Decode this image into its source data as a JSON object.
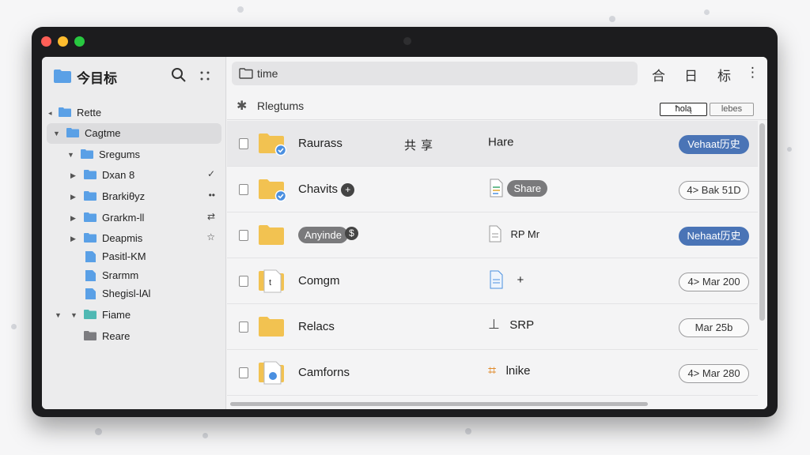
{
  "colors": {
    "accent": "#4a74b6",
    "folder": "#5aa0e6",
    "folder_yellow": "#f2c251",
    "traffic_red": "#ff5f57",
    "traffic_yellow": "#febc2e",
    "traffic_green": "#28c840"
  },
  "sidebar": {
    "title": "今目标",
    "icons": [
      "folder-icon",
      "search-icon",
      "grid-icon"
    ],
    "items": [
      {
        "label": "Rette",
        "chevron": "◂",
        "trail": ""
      },
      {
        "label": "Cagtme",
        "chevron": "▼",
        "trail": ""
      },
      {
        "label": "Sregums",
        "chevron": "▼",
        "trail": ""
      },
      {
        "label": "Dxan 8",
        "chevron": "▶",
        "trail": "✓"
      },
      {
        "label": "Brarkiθyz",
        "chevron": "▶",
        "trail": "••"
      },
      {
        "label": "Grarkm-ll",
        "chevron": "▶",
        "trail": "⇄"
      },
      {
        "label": "Deapmis",
        "chevron": "▶",
        "trail": "☆"
      },
      {
        "label": "Pasitl-KM",
        "chevron": "",
        "trail": ""
      },
      {
        "label": "Srarmm",
        "chevron": "",
        "trail": ""
      },
      {
        "label": "Shegisl-lAl",
        "chevron": "",
        "trail": ""
      },
      {
        "label": "Fiame",
        "chevron": "▼",
        "trail": ""
      },
      {
        "label": "Reare",
        "chevron": "",
        "trail": ""
      }
    ]
  },
  "toolbar": {
    "path_label": "time",
    "buttons": [
      "合",
      "日",
      "标",
      "⋮"
    ]
  },
  "section": {
    "title": "Rlegtums",
    "seg_a": "ħolą",
    "seg_b": "lebes"
  },
  "rows": [
    {
      "name": "Raurass",
      "col2": "共享",
      "col3_text": "Hare",
      "col3_pill": "",
      "tag": "Vehaat历史",
      "tag_style": "blue"
    },
    {
      "name": "Chavits",
      "col2": "",
      "col3_text": "",
      "col3_pill": "Share",
      "tag": "4> Bak 51D",
      "tag_style": "out"
    },
    {
      "name": "",
      "name_pill": "Anyinde",
      "col2": "",
      "col3_text": "RP Mr",
      "col3_pill": "",
      "tag": "Nehaat历史",
      "tag_style": "blue"
    },
    {
      "name": "Comgm",
      "col2": "",
      "col3_text": "+",
      "col3_pill": "",
      "tag": "4> Mar 200",
      "tag_style": "out"
    },
    {
      "name": "Relacs",
      "col2": "",
      "col3_text": "SRP",
      "col3_pill": "",
      "tag": "Mar 25b",
      "tag_style": "out"
    },
    {
      "name": "Camforns",
      "col2": "",
      "col3_text": "lnike",
      "col3_pill": "",
      "tag": "4> Mar 280",
      "tag_style": "out"
    }
  ]
}
